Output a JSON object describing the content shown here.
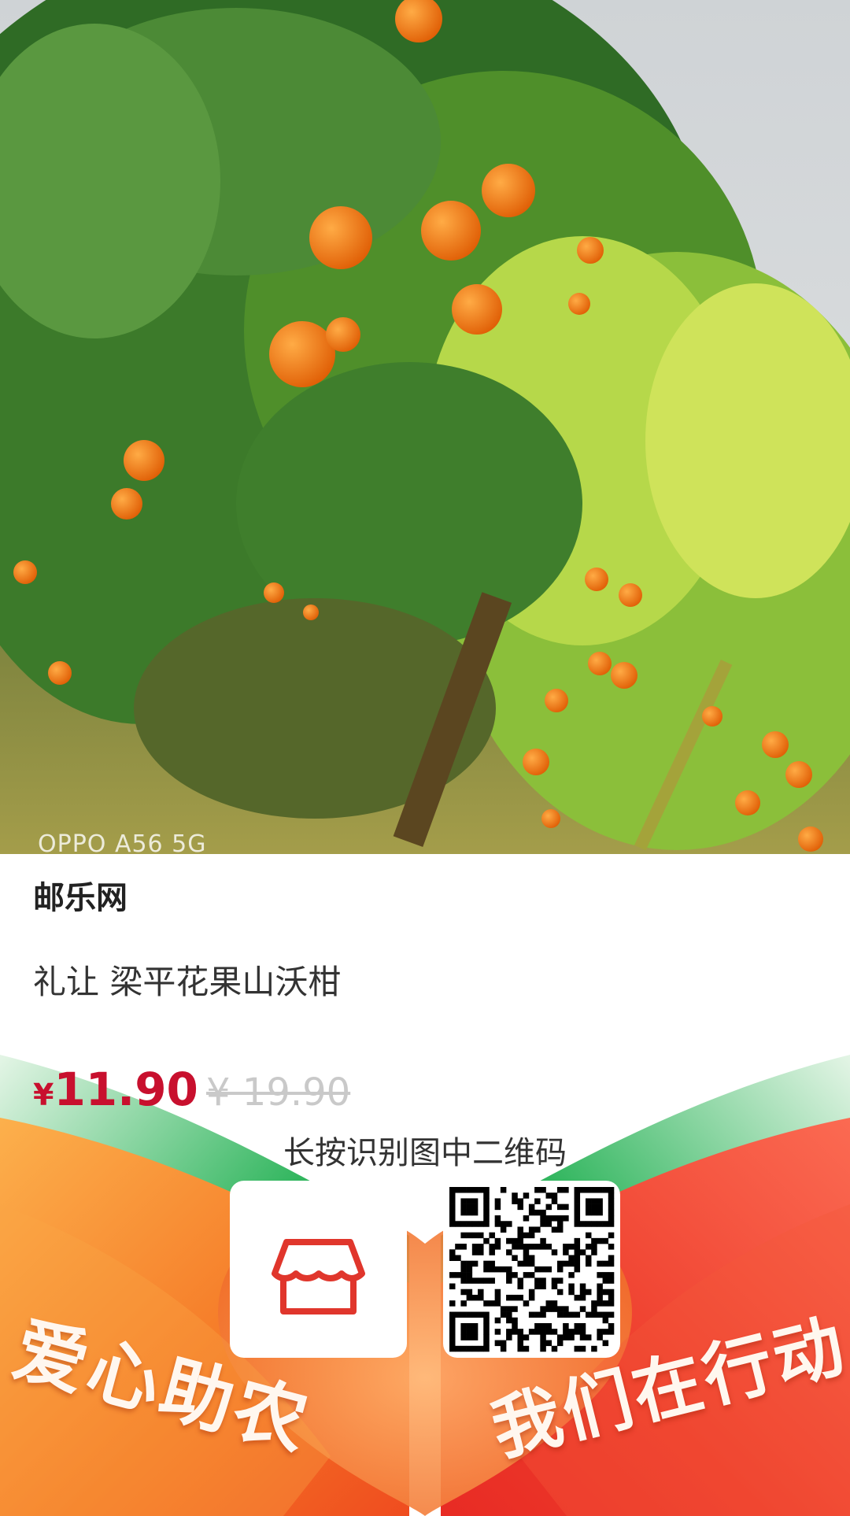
{
  "photo": {
    "description_icon": "orange-tree-photo",
    "watermark": "OPPO A56 5G"
  },
  "product": {
    "brand": "邮乐网",
    "title": "礼让 梁平花果山沃柑",
    "currency_symbol": "¥",
    "price": "11.90",
    "original_price": "¥ 19.90"
  },
  "poster": {
    "qr_hint": "长按识别图中二维码",
    "shop_icon": "shop-icon",
    "qr_icon": "qr-code-icon",
    "slogan_left": "爱心助农",
    "slogan_right": "我们在行动"
  },
  "colors": {
    "price": "#c8102e",
    "banner_red": "#e8352a",
    "banner_orange": "#f78b2a",
    "banner_green": "#1fb15a"
  }
}
